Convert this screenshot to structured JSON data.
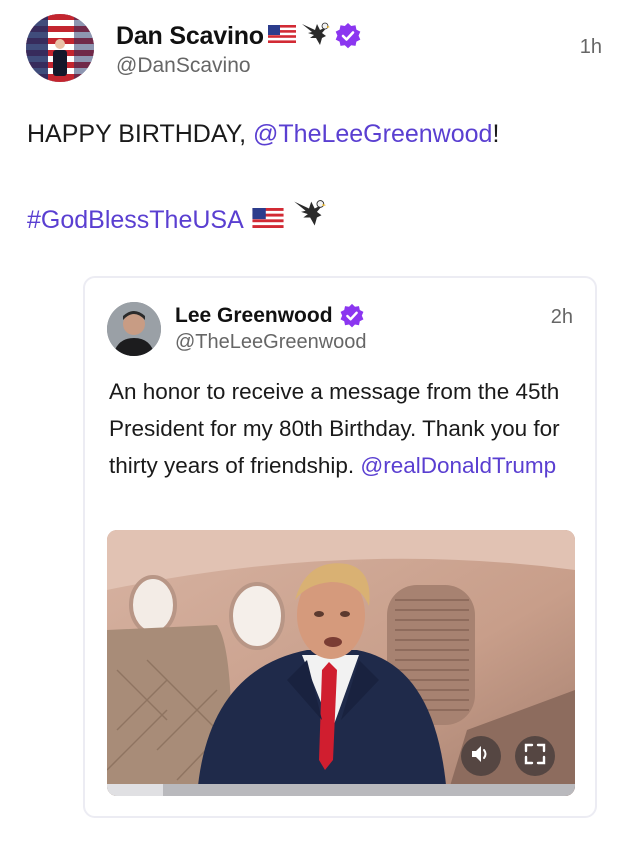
{
  "post": {
    "author": {
      "display_name": "Dan Scavino",
      "handle": "@DanScavino",
      "verified": true,
      "name_emojis": [
        "us-flag",
        "eagle"
      ]
    },
    "timestamp": "1h",
    "text_prefix": "HAPPY BIRTHDAY, ",
    "mention": "@TheLeeGreenwood",
    "text_suffix": "!",
    "hashtag": "#GodBlessTheUSA",
    "hashtag_emojis": [
      "us-flag",
      "eagle"
    ]
  },
  "quoted": {
    "author": {
      "display_name": "Lee Greenwood",
      "handle": "@TheLeeGreenwood",
      "verified": true
    },
    "timestamp": "2h",
    "text": "An honor to receive a message from the 45th President for my 80th Birthday. Thank you for thirty years of friendship. ",
    "mention": "@realDonaldTrump",
    "video": {
      "controls": [
        "speaker-icon",
        "fullscreen-icon"
      ],
      "progress": 0.12
    }
  },
  "colors": {
    "link": "#5a3fd1",
    "verified_badge": "#8b36f0",
    "secondary_text": "#666666"
  }
}
